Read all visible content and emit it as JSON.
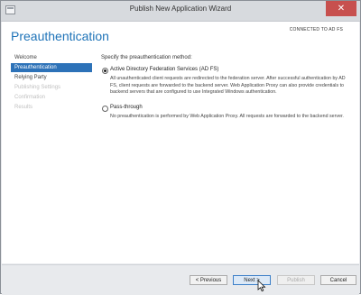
{
  "window": {
    "title": "Publish New Application Wizard",
    "close_glyph": "✕"
  },
  "header": {
    "page_title": "Preauthentication",
    "server_status": "CONNECTED TO AD FS"
  },
  "sidebar": {
    "items": [
      {
        "label": "Welcome",
        "state": "normal"
      },
      {
        "label": "Preauthentication",
        "state": "active"
      },
      {
        "label": "Relying Party",
        "state": "normal"
      },
      {
        "label": "Publishing Settings",
        "state": "disabled"
      },
      {
        "label": "Confirmation",
        "state": "disabled"
      },
      {
        "label": "Results",
        "state": "disabled"
      }
    ]
  },
  "main": {
    "prompt": "Specify the preauthentication method:",
    "options": [
      {
        "label": "Active Directory Federation Services (AD FS)",
        "selected": true,
        "description": "All unauthenticated client requests are redirected to the federation server. After successful authentication by AD FS, client requests are forwarded to the backend server. Web Application Proxy can also provide credentials to backend servers that are configured to use Integrated Windows authentication."
      },
      {
        "label": "Pass-through",
        "selected": false,
        "description": "No preauthentication is performed by Web Application Proxy. All requests are forwarded to the backend server."
      }
    ]
  },
  "footer": {
    "previous_label": "< Previous",
    "next_label": "Next >",
    "publish_label": "Publish",
    "cancel_label": "Cancel"
  },
  "colors": {
    "accent": "#2d72b8",
    "title_blue": "#1e73b8",
    "close_red": "#c7504e"
  }
}
